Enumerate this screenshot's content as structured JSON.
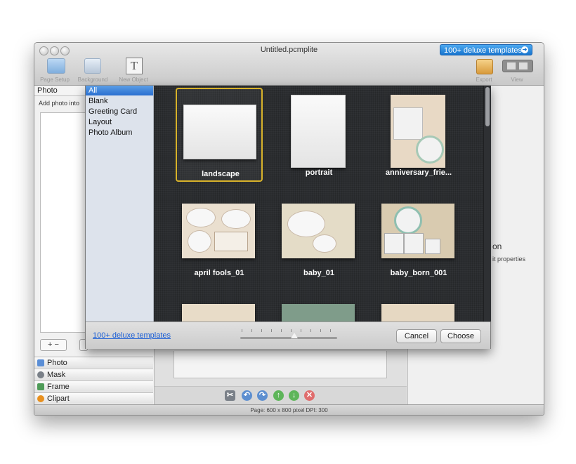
{
  "window": {
    "title": "Untitled.pcmplite",
    "deluxe_button": "100+ deluxe templates"
  },
  "toolbar": {
    "left": [
      {
        "label": "Page Setup",
        "icon": "page-setup-icon"
      },
      {
        "label": "Background",
        "icon": "background-icon"
      },
      {
        "label": "New Object",
        "icon": "text-object-icon"
      }
    ],
    "right": [
      {
        "label": "Export",
        "icon": "export-icon"
      },
      {
        "label": "View",
        "icon": "view-icon"
      }
    ]
  },
  "sidebar": {
    "header": "Photo",
    "add_photo": "Add photo into",
    "plus_minus": "+ −",
    "panels": [
      {
        "label": "Photo",
        "icon": "photo-icon"
      },
      {
        "label": "Mask",
        "icon": "mask-icon"
      },
      {
        "label": "Frame",
        "icon": "frame-icon"
      },
      {
        "label": "Clipart",
        "icon": "clipart-icon"
      }
    ]
  },
  "template_sheet": {
    "categories": [
      "All",
      "Blank",
      "Greeting Card",
      "Layout",
      "Photo Album"
    ],
    "selected_category": "All",
    "templates": [
      {
        "label": "landscape",
        "selected": true
      },
      {
        "label": "portrait",
        "selected": false
      },
      {
        "label": "anniversary_frie...",
        "selected": false
      },
      {
        "label": "april fools_01",
        "selected": false
      },
      {
        "label": "baby_01",
        "selected": false
      },
      {
        "label": "baby_born_001",
        "selected": false
      }
    ],
    "deluxe_link": "100+ deluxe templates",
    "cancel": "Cancel",
    "choose": "Choose"
  },
  "inspector": {
    "heading_fragment": "on",
    "subtext_fragment": "it properties"
  },
  "status": {
    "text": "Page: 600 x 800 pixel DPI: 300"
  },
  "colors": {
    "accent_blue": "#1875cf",
    "selection_gold": "#d8b22a",
    "grid_background": "#2b2d30"
  }
}
